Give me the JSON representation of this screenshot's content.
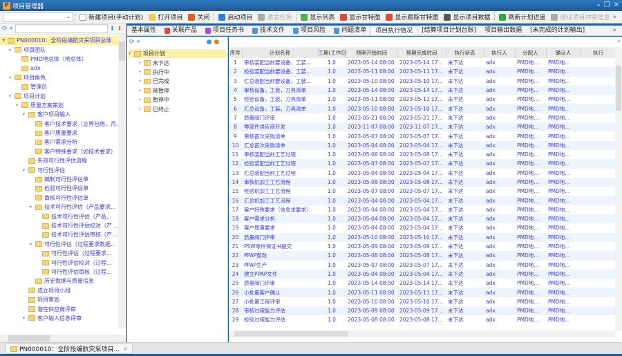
{
  "app": {
    "title": "项目管理器"
  },
  "toolbar": {
    "items": [
      {
        "label": "新建项目(手动计划)",
        "icon": "new-doc-icon",
        "color": "#ffffff",
        "enabled": true
      },
      {
        "label": "打开项目",
        "icon": "folder-open-icon",
        "color": "#f3c957",
        "enabled": true
      },
      {
        "label": "关闭",
        "icon": "close-project-icon",
        "color": "#e85a1c",
        "enabled": true
      },
      {
        "label": "启动项目",
        "icon": "start-icon",
        "color": "#2a7de1",
        "enabled": true
      },
      {
        "label": "激发任务",
        "icon": "trigger-icon",
        "color": "#aaaaaa",
        "enabled": false
      },
      {
        "label": "显示列表",
        "icon": "list-icon",
        "color": "#4caf50",
        "enabled": true
      },
      {
        "label": "显示甘特图",
        "icon": "gantt-icon",
        "color": "#e0483a",
        "enabled": true
      },
      {
        "label": "显示跟踪甘特图",
        "icon": "tracking-gantt-icon",
        "color": "#e0483a",
        "enabled": true
      },
      {
        "label": "显示项目数据",
        "icon": "data-icon",
        "color": "#555555",
        "enabled": true
      },
      {
        "label": "刷新计划进度",
        "icon": "refresh-icon",
        "color": "#2eaa3c",
        "enabled": true
      },
      {
        "label": "验证项目冲突信息",
        "icon": "verify-icon",
        "color": "#aaaaaa",
        "enabled": false
      }
    ]
  },
  "left_tree": {
    "nodes": [
      {
        "label": "PN000010：全阶段编航灾采项目总体",
        "depth": 0,
        "toggle": "▼",
        "selected": true
      },
      {
        "label": "项目团队",
        "depth": 1,
        "toggle": "▾"
      },
      {
        "label": "PMD地总体（地总体）",
        "depth": 2,
        "toggle": ""
      },
      {
        "label": "adx",
        "depth": 2,
        "toggle": ""
      },
      {
        "label": "项目角色",
        "depth": 1,
        "toggle": "▾"
      },
      {
        "label": "管理员",
        "depth": 2,
        "toggle": ""
      },
      {
        "label": "项目计划",
        "depth": 1,
        "toggle": "▾"
      },
      {
        "label": "质量方案策划",
        "depth": 2,
        "toggle": "▾"
      },
      {
        "label": "客户项目输入",
        "depth": 3,
        "toggle": "▾"
      },
      {
        "label": "客户技术要求（业界包络，月...",
        "depth": 4,
        "toggle": ""
      },
      {
        "label": "客户质量要求",
        "depth": 4,
        "toggle": ""
      },
      {
        "label": "客户需求分析",
        "depth": 4,
        "toggle": ""
      },
      {
        "label": "客户特殊要求（如技术要求）",
        "depth": 4,
        "toggle": ""
      },
      {
        "label": "失效可行性评估流程",
        "depth": 3,
        "toggle": ""
      },
      {
        "label": "可行性评估",
        "depth": 3,
        "toggle": "▾"
      },
      {
        "label": "编制可行性评估单",
        "depth": 4,
        "toggle": ""
      },
      {
        "label": "检验可行性评估单",
        "depth": 4,
        "toggle": ""
      },
      {
        "label": "审核可行性评估单",
        "depth": 4,
        "toggle": ""
      },
      {
        "label": "技术可行性评估（产品要求...",
        "depth": 4,
        "toggle": "▾"
      },
      {
        "label": "技术可行性评估（产品...",
        "depth": 5,
        "toggle": ""
      },
      {
        "label": "技术可行性评估校对（产...",
        "depth": 5,
        "toggle": ""
      },
      {
        "label": "技术可行性评估审核（产...",
        "depth": 5,
        "toggle": ""
      },
      {
        "label": "可行性评估（过程要求数据...",
        "depth": 4,
        "toggle": "▾"
      },
      {
        "label": "可行性评估（过程要求...",
        "depth": 5,
        "toggle": ""
      },
      {
        "label": "可行性评估校对（过程...",
        "depth": 5,
        "toggle": ""
      },
      {
        "label": "可行性评估审核（过程...",
        "depth": 5,
        "toggle": ""
      },
      {
        "label": "历史数据与质量信息",
        "depth": 4,
        "toggle": ""
      },
      {
        "label": "成立项目小组",
        "depth": 3,
        "toggle": ""
      },
      {
        "label": "项目策划",
        "depth": 3,
        "toggle": ""
      },
      {
        "label": "潜在供应商评审",
        "depth": 3,
        "toggle": ""
      },
      {
        "label": "客户输入信息评审",
        "depth": 3,
        "toggle": "▾"
      }
    ]
  },
  "tabs": [
    {
      "label": "基本属性",
      "icon": ""
    },
    {
      "label": "关联产品",
      "icon": "product-icon"
    },
    {
      "label": "项目任务书",
      "icon": "task-book-icon"
    },
    {
      "label": "技术文件",
      "icon": "doc-icon"
    },
    {
      "label": "项目风险",
      "icon": "doc-icon"
    },
    {
      "label": "问题清单",
      "icon": "doc-icon"
    },
    {
      "label": "项目执行情况",
      "icon": "",
      "active": true
    },
    {
      "label": "[结算项目计划台账]",
      "icon": ""
    },
    {
      "label": "项目输出数据",
      "icon": ""
    },
    {
      "label": "[未完成的计划输出]",
      "icon": ""
    }
  ],
  "status_tree": {
    "root": "项目计划",
    "children": [
      "未下达",
      "执行中",
      "已完成",
      "被暂停",
      "暂停中",
      "已终止"
    ]
  },
  "table": {
    "columns": [
      "序号",
      "计划名称",
      "工期(工作日)",
      "预期开始时间",
      "预期完成时间",
      "执行状态",
      "执行人",
      "分配人",
      "确认人",
      "执行"
    ],
    "rows": [
      [
        "1",
        "审核装配当前要设备，工装...",
        "1.0",
        "2023-05-14 08:00",
        "2023-05-14 17:00",
        "未下达",
        "adx",
        "PMD地总体",
        "PMD地..."
      ],
      [
        "2",
        "检验装配当前要设备，工装...",
        "1.0",
        "2023-05-11 08:00",
        "2023-05-11 17:00",
        "未下达",
        "adx",
        "PMD地总体",
        "PMD地..."
      ],
      [
        "3",
        "汇总装配当前要设备，工装...",
        "1.0",
        "2023-05-10 08:00",
        "2023-05-10 17:00",
        "未下达",
        "adx",
        "PMD地总体",
        "PMD地..."
      ],
      [
        "4",
        "审核设备，工装，刀具清单",
        "1.0",
        "2023-05-14 08:00",
        "2023-05-14 17:00",
        "未下达",
        "adx",
        "PMD地总体",
        "PMD地..."
      ],
      [
        "5",
        "检验设备，工装，刀具清单",
        "1.0",
        "2023-05-11 08:00",
        "2023-05-11 17:00",
        "未下达",
        "adx",
        "PMD地总体",
        "PMD地..."
      ],
      [
        "6",
        "汇总设备，工装，刀具清单",
        "1.0",
        "2023-05-10 08:00",
        "2023-05-10 17:00",
        "未下达",
        "adx",
        "PMD地总体",
        "PMD地..."
      ],
      [
        "7",
        "质量阀门评审",
        "1.0",
        "2023-05-21 08:00",
        "2023-05-21 17:00",
        "未下达",
        "adx",
        "PMD地总体",
        "PMD地..."
      ],
      [
        "8",
        "零部件供应商开发",
        "1.0",
        "2023-11-07 08:00",
        "2023-11-07 17:00",
        "未下达",
        "adx",
        "PMD地总体",
        "PMD地..."
      ],
      [
        "9",
        "审核首次采购清单",
        "1.0",
        "2023-05-07 08:00",
        "2023-05-07 17:00",
        "未下达",
        "adx",
        "PMD地总体",
        "PMD地..."
      ],
      [
        "10",
        "汇总首次采购清单",
        "1.0",
        "2023-05-04 08:00",
        "2023-05-04 17:00",
        "未下达",
        "adx",
        "PMD地总体",
        "PMD地..."
      ],
      [
        "11",
        "审核装配当前工艺过程",
        "1.0",
        "2023-05-08 08:00",
        "2023-05-08 17:00",
        "未下达",
        "adx",
        "PMD地总体",
        "PMD地..."
      ],
      [
        "12",
        "检验装配当前工艺过程",
        "1.0",
        "2023-05-07 08:00",
        "2023-05-07 17:00",
        "未下达",
        "adx",
        "PMD地总体",
        "PMD地..."
      ],
      [
        "13",
        "汇总装配当前工艺过程",
        "1.0",
        "2023-05-04 08:00",
        "2023-05-04 17:00",
        "未下达",
        "adx",
        "PMD地总体",
        "PMD地..."
      ],
      [
        "14",
        "审核机加工工艺流程",
        "1.0",
        "2023-05-08 08:00",
        "2023-05-08 17:00",
        "未下达",
        "adx",
        "PMD地总体",
        "PMD地..."
      ],
      [
        "15",
        "检验机加工工艺流程",
        "1.0",
        "2023-05-07 08:00",
        "2023-05-07 17:00",
        "未下达",
        "adx",
        "PMD地总体",
        "PMD地..."
      ],
      [
        "16",
        "汇总机加工工艺流程",
        "1.0",
        "2023-05-04 08:00",
        "2023-05-04 17:00",
        "未下达",
        "adx",
        "PMD地总体",
        "PMD地..."
      ],
      [
        "17",
        "客户特殊要求（信息求要求）",
        "1.0",
        "2023-05-04 08:00",
        "2023-05-04 17:00",
        "未下达",
        "adx",
        "PMD地总体",
        "PMD地..."
      ],
      [
        "18",
        "客户需求分析",
        "1.0",
        "2023-05-04 08:00",
        "2023-05-04 17:00",
        "未下达",
        "adx",
        "PMD地总体",
        "PMD地..."
      ],
      [
        "19",
        "客户质量要求",
        "1.0",
        "2023-05-04 08:00",
        "2023-05-04 17:00",
        "未下达",
        "adx",
        "PMD地总体",
        "PMD地..."
      ],
      [
        "20",
        "质量阀门评审",
        "1.0",
        "2023-05-10 08:00",
        "2023-05-10 17:00",
        "未下达",
        "adx",
        "PMD地总体",
        "PMD地..."
      ],
      [
        "21",
        "PSW零件保证书提交",
        "1.0",
        "2023-05-09 08:00",
        "2023-05-09 17:00",
        "未下达",
        "adx",
        "PMD地总体",
        "PMD地..."
      ],
      [
        "22",
        "PPAP整改",
        "1.0",
        "2023-05-08 08:00",
        "2023-05-08 17:00",
        "未下达",
        "adx",
        "PMD地总体",
        "PMD地..."
      ],
      [
        "23",
        "PPAP生产",
        "1.0",
        "2023-05-07 08:00",
        "2023-05-07 17:00",
        "未下达",
        "adx",
        "PMD地总体",
        "PMD地..."
      ],
      [
        "24",
        "建立PPAP文件",
        "1.0",
        "2023-05-04 08:00",
        "2023-05-04 17:00",
        "未下达",
        "adx",
        "PMD地总体",
        "PMD地..."
      ],
      [
        "25",
        "质量阀门评审",
        "1.0",
        "2023-05-14 08:00",
        "2023-05-14 17:00",
        "未下达",
        "adx",
        "PMD地总体",
        "PMD地..."
      ],
      [
        "26",
        "小批量客户确认",
        "1.0",
        "2023-05-11 08:00",
        "2023-05-11 17:00",
        "未下达",
        "adx",
        "PMD地总体",
        "PMD地..."
      ],
      [
        "27",
        "小批量工程评审",
        "1.0",
        "2023-05-10 08:00",
        "2023-05-10 17:00",
        "未下达",
        "adx",
        "PMD地总体",
        "PMD地..."
      ],
      [
        "28",
        "审核过程能力评估",
        "1.0",
        "2023-05-09 08:00",
        "2023-05-09 17:00",
        "未下达",
        "adx",
        "PMD地总体",
        "PMD地..."
      ],
      [
        "29",
        "检验过程能力评估",
        "1.0",
        "2023-05-08 08:00",
        "2023-05-08 17:00",
        "未下达",
        "adx",
        "PMD地总体",
        "PMD地..."
      ]
    ]
  },
  "status_bar": {
    "tab_label": "PN000010：全阶段编航灾采项目...",
    "close": "×"
  }
}
